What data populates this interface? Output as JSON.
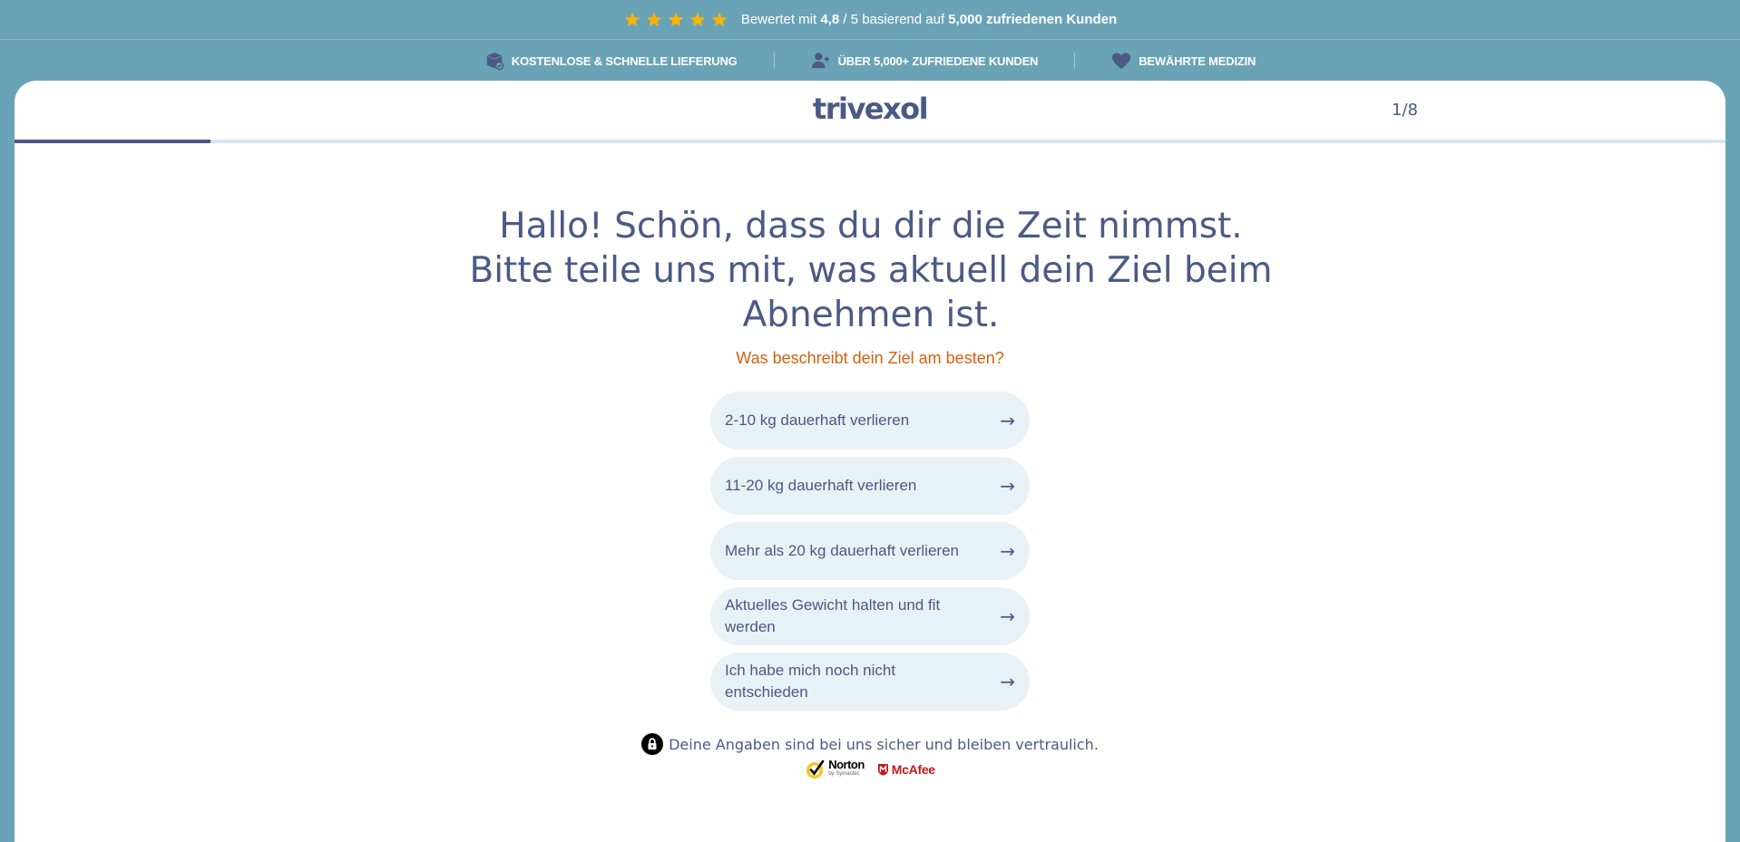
{
  "rating_bar": {
    "prefix": "Bewertet mit",
    "score": "4,8",
    "scale": "/ 5 basierend auf",
    "customers": "5,000 zufriedenen Kunden",
    "star_count": 5,
    "star_color": "#f6b20c"
  },
  "benefits": [
    {
      "label": "KOSTENLOSE & SCHNELLE LIEFERUNG",
      "icon": "delivery-box-icon"
    },
    {
      "label": "ÜBER 5,000+ ZUFRIEDENE KUNDEN",
      "icon": "add-user-icon"
    },
    {
      "label": "BEWÄHRTE MEDIZIN",
      "icon": "heart-icon"
    }
  ],
  "header": {
    "logo": "trivexol",
    "step": "1/8",
    "progress": 0.125
  },
  "main": {
    "headline": "Hallo! Schön, dass du dir die Zeit nimmst. Bitte teile uns mit, was aktuell dein Ziel beim Abnehmen ist.",
    "question": "Was beschreibt dein Ziel am besten?",
    "options": [
      {
        "label": "2-10 kg dauerhaft verlieren",
        "icon": "arrow-right-icon"
      },
      {
        "label": "11-20 kg dauerhaft verlieren",
        "icon": "arrow-right-icon"
      },
      {
        "label": "Mehr als 20 kg dauerhaft verlieren",
        "icon": "arrow-right-icon"
      },
      {
        "label": "Aktuelles Gewicht halten und fit werden",
        "icon": "arrow-right-icon"
      },
      {
        "label": "Ich habe mich noch nicht entschieden",
        "icon": "arrow-right-icon"
      }
    ]
  },
  "footer": {
    "privacy_text": "Deine Angaben sind bei uns sicher und bleiben vertraulich.",
    "badges": {
      "norton": "Norton",
      "norton_sub": "by Symantec",
      "mcafee": "McAfee"
    }
  },
  "colors": {
    "background": "#6aa3b6",
    "primary": "#4a5a85",
    "accent_orange": "#d4600e",
    "option_bg": "#e8f1f5",
    "progress_track": "#d3e8ef"
  }
}
